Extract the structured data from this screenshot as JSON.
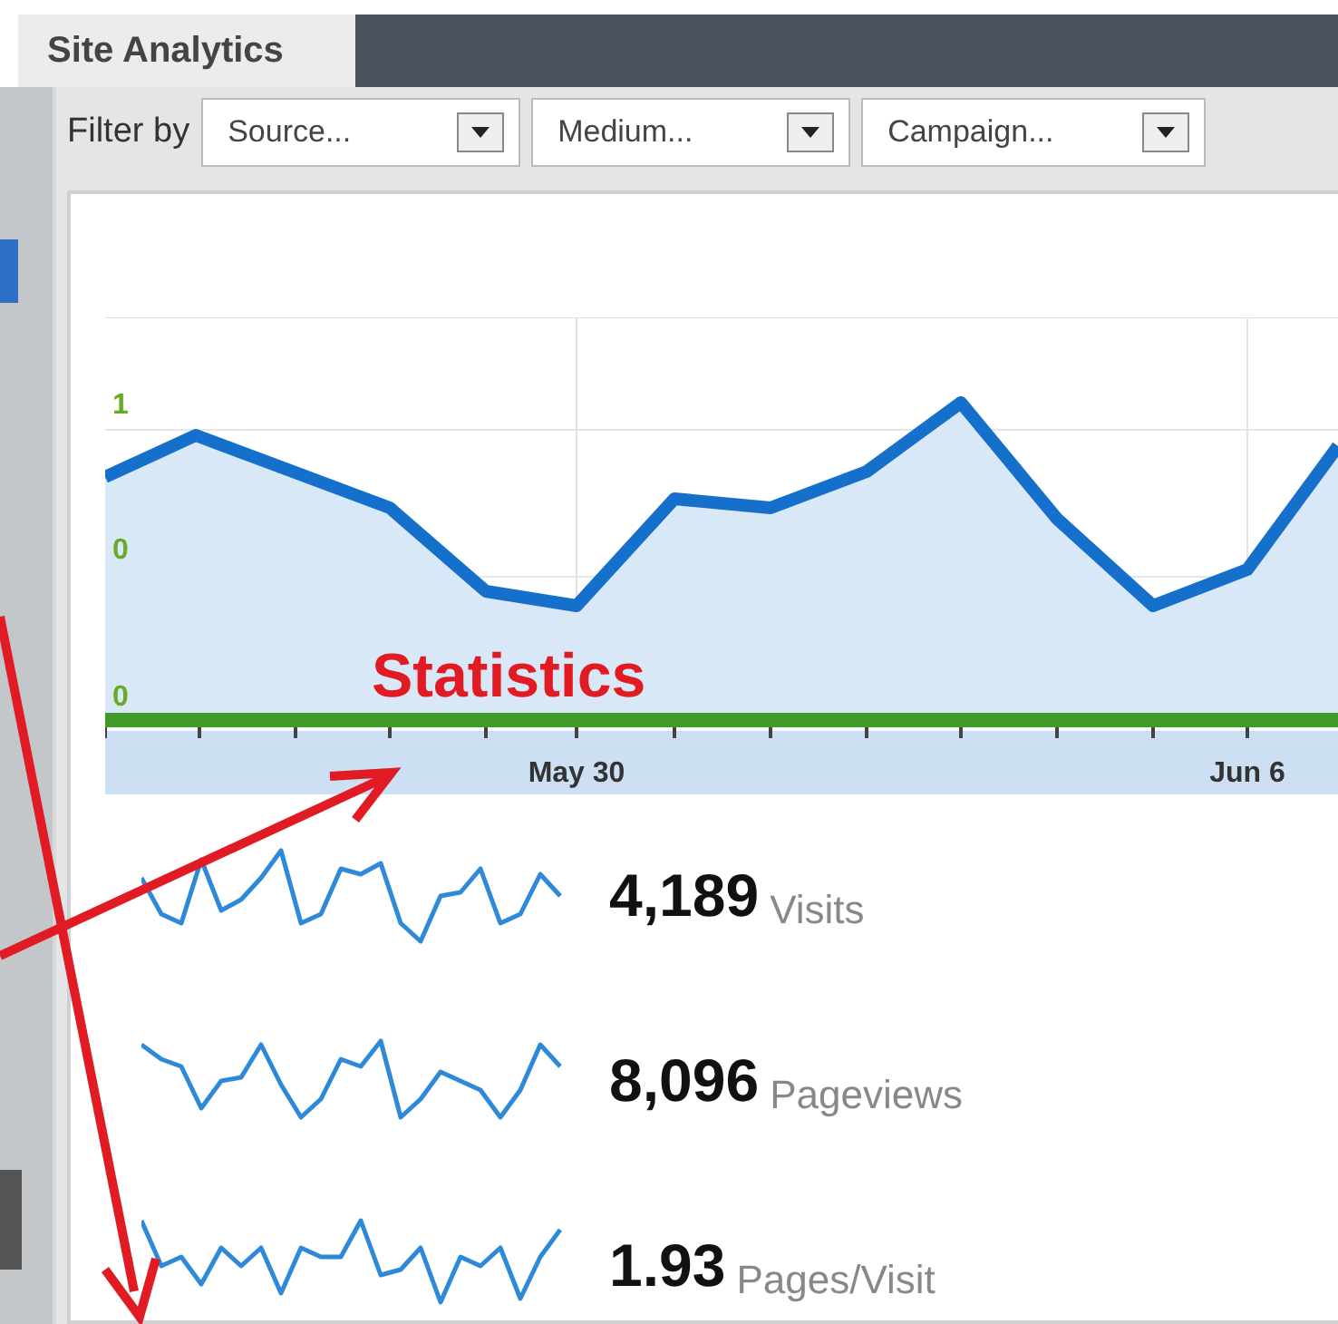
{
  "tabs": [
    {
      "label": "Site Analytics",
      "selected": true
    }
  ],
  "filter": {
    "label": "Filter by",
    "dropdowns": [
      {
        "value": "Source..."
      },
      {
        "value": "Medium..."
      },
      {
        "value": "Campaign..."
      }
    ]
  },
  "main_chart": {
    "y_labels": [
      "1",
      "0",
      "0"
    ],
    "x_labels": [
      "May 30",
      "Jun 6"
    ]
  },
  "metrics": [
    {
      "value": "4,189",
      "label": "Visits"
    },
    {
      "value": "8,096",
      "label": "Pageviews"
    },
    {
      "value": "1.93",
      "label": "Pages/Visit"
    }
  ],
  "annotation": {
    "label": "Statistics"
  }
}
